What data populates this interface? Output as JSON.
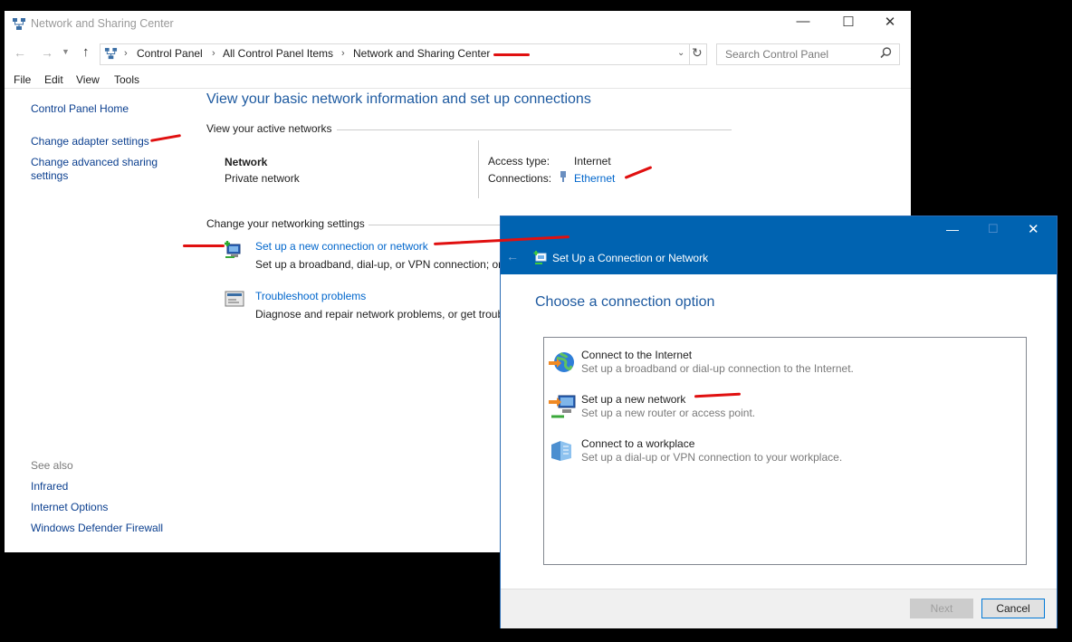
{
  "main_window": {
    "title": "Network and Sharing Center",
    "address": {
      "breadcrumbs": [
        "Control Panel",
        "All Control Panel Items",
        "Network and Sharing Center"
      ],
      "search_placeholder": "Search Control Panel"
    },
    "menu": [
      "File",
      "Edit",
      "View",
      "Tools"
    ],
    "sidebar": {
      "home": "Control Panel Home",
      "links": [
        "Change adapter settings",
        "Change advanced sharing",
        "settings"
      ],
      "see_also_label": "See also",
      "see_also": [
        "Infrared",
        "Internet Options",
        "Windows Defender Firewall"
      ]
    },
    "content": {
      "heading": "View your basic network information and set up connections",
      "active_networks_label": "View your active networks",
      "network_name": "Network",
      "network_type": "Private network",
      "access_type_label": "Access type:",
      "access_type_value": "Internet",
      "connections_label": "Connections:",
      "connections_value": "Ethernet",
      "change_settings_label": "Change your networking settings",
      "tasks": [
        {
          "title": "Set up a new connection or network",
          "desc": "Set up a broadband, dial-up, or VPN connection; or"
        },
        {
          "title": "Troubleshoot problems",
          "desc": "Diagnose and repair network problems, or get troub"
        }
      ]
    }
  },
  "dialog": {
    "title": "Set Up a Connection or Network",
    "heading": "Choose a connection option",
    "options": [
      {
        "title": "Connect to the Internet",
        "desc": "Set up a broadband or dial-up connection to the Internet.",
        "icon": "globe-icon"
      },
      {
        "title": "Set up a new network",
        "desc": "Set up a new router or access point.",
        "icon": "network-setup-icon"
      },
      {
        "title": "Connect to a workplace",
        "desc": "Set up a dial-up or VPN connection to your workplace.",
        "icon": "workplace-icon"
      }
    ],
    "buttons": {
      "next": "Next",
      "cancel": "Cancel"
    }
  },
  "colors": {
    "accent": "#0063b1",
    "link": "#0066cc",
    "annotation": "#e01010"
  }
}
